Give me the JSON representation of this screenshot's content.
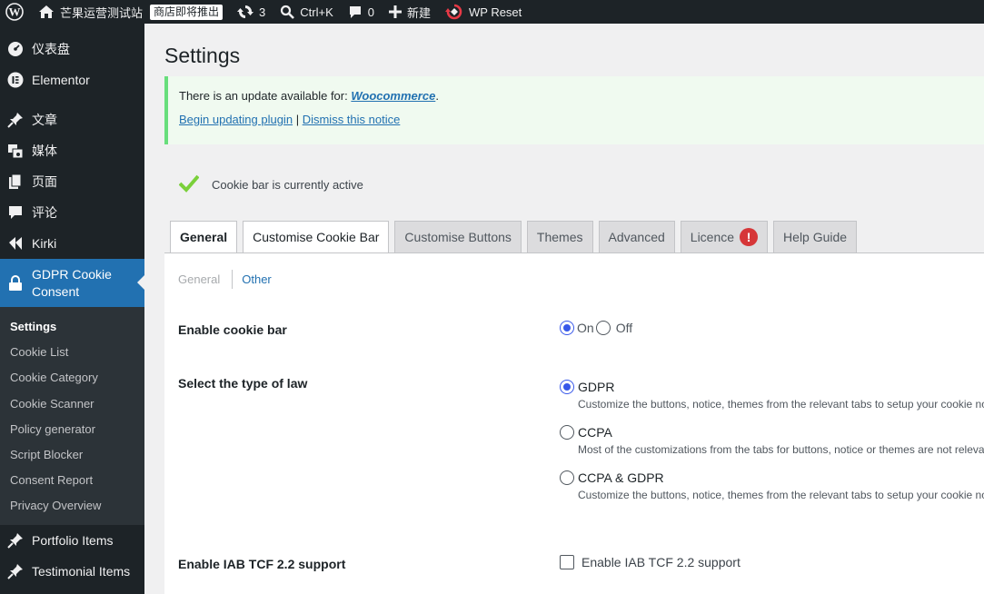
{
  "adminbar": {
    "site_name": "芒果运营测试站",
    "site_badge": "商店即将推出",
    "updates_count": "3",
    "search_shortcut": "Ctrl+K",
    "comments_count": "0",
    "new_label": "新建",
    "wp_reset_label": "WP Reset"
  },
  "sidebar": {
    "items": [
      {
        "label": "仪表盘",
        "icon": "dashboard-icon"
      },
      {
        "label": "Elementor",
        "icon": "elementor-icon"
      },
      {
        "label": "文章",
        "icon": "pin-icon"
      },
      {
        "label": "媒体",
        "icon": "media-icon"
      },
      {
        "label": "页面",
        "icon": "page-icon"
      },
      {
        "label": "评论",
        "icon": "comment-icon"
      },
      {
        "label": "Kirki",
        "icon": "kirki-icon"
      },
      {
        "label": "GDPR Cookie Consent",
        "icon": "lock-icon"
      },
      {
        "label": "Portfolio Items",
        "icon": "pin-icon"
      },
      {
        "label": "Testimonial Items",
        "icon": "pin-icon"
      }
    ],
    "submenu": [
      "Settings",
      "Cookie List",
      "Cookie Category",
      "Cookie Scanner",
      "Policy generator",
      "Script Blocker",
      "Consent Report",
      "Privacy Overview"
    ]
  },
  "page": {
    "title": "Settings",
    "notice_prefix": "There is an update available for: ",
    "notice_plugin": "Woocommerce",
    "notice_suffix": ".",
    "begin_update": "Begin updating plugin",
    "separator": "|",
    "dismiss": "Dismiss this notice",
    "status_text": "Cookie bar is currently active",
    "colors": {
      "accent": "#2271b1",
      "radio": "#3858e9",
      "success": "#68de7c",
      "warning": "#d63638",
      "check": "#7ad03a"
    }
  },
  "tabs": [
    "General",
    "Customise Cookie Bar",
    "Customise Buttons",
    "Themes",
    "Advanced",
    "Licence",
    "Help Guide"
  ],
  "subtabs": [
    "General",
    "Other"
  ],
  "settings": {
    "enable_cookie_bar": {
      "label": "Enable cookie bar",
      "on": "On",
      "off": "Off",
      "selected": "On"
    },
    "law": {
      "label": "Select the type of law",
      "options": [
        {
          "name": "GDPR",
          "desc": "Customize the buttons, notice, themes from the relevant tabs to setup your cookie noti",
          "selected": true
        },
        {
          "name": "CCPA",
          "desc": "Most of the customizations from the tabs for buttons, notice or themes are not relevant",
          "selected": false
        },
        {
          "name": "CCPA & GDPR",
          "desc": "Customize the buttons, notice, themes from the relevant tabs to setup your cookie noti",
          "selected": false
        }
      ]
    },
    "iab": {
      "label": "Enable IAB TCF 2.2 support",
      "checkbox_label": "Enable IAB TCF 2.2 support",
      "checked": false
    }
  }
}
